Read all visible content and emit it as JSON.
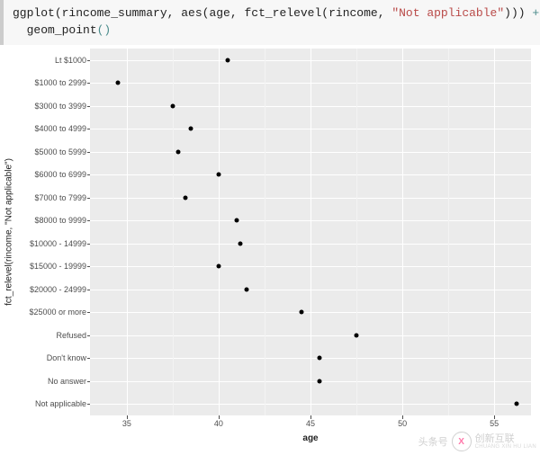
{
  "code": {
    "prefix1a": "ggplot",
    "prefix1b": "(rincome_summary, ",
    "prefix1c": "aes",
    "prefix1d": "(age, ",
    "prefix1e": "fct_relevel",
    "prefix1f": "(rincome, ",
    "string": "\"Not applicable\"",
    "suffix1": "))) ",
    "plus": "+",
    "line2a": "  geom_point",
    "line2b": "()"
  },
  "chart_data": {
    "type": "scatter",
    "xlabel": "age",
    "ylabel": "fct_relevel(rincome, \"Not applicable\")",
    "xlim": [
      33,
      57
    ],
    "x_ticks": [
      35,
      40,
      45,
      50,
      55
    ],
    "categories": [
      "Lt $1000",
      "$1000 to 2999",
      "$3000 to 3999",
      "$4000 to 4999",
      "$5000 to 5999",
      "$6000 to 6999",
      "$7000 to 7999",
      "$8000 to 9999",
      "$10000 - 14999",
      "$15000 - 19999",
      "$20000 - 24999",
      "$25000 or more",
      "Refused",
      "Don't know",
      "No answer",
      "Not applicable"
    ],
    "x": [
      40.5,
      34.5,
      37.5,
      38.5,
      37.8,
      40.0,
      38.2,
      41.0,
      41.2,
      40.0,
      41.5,
      44.5,
      47.5,
      45.5,
      45.5,
      56.2
    ]
  },
  "watermark": {
    "brand": "头条号",
    "logo_letter": "X",
    "name": "创新互联",
    "sub": "CHUANG XIN HU LIAN"
  }
}
